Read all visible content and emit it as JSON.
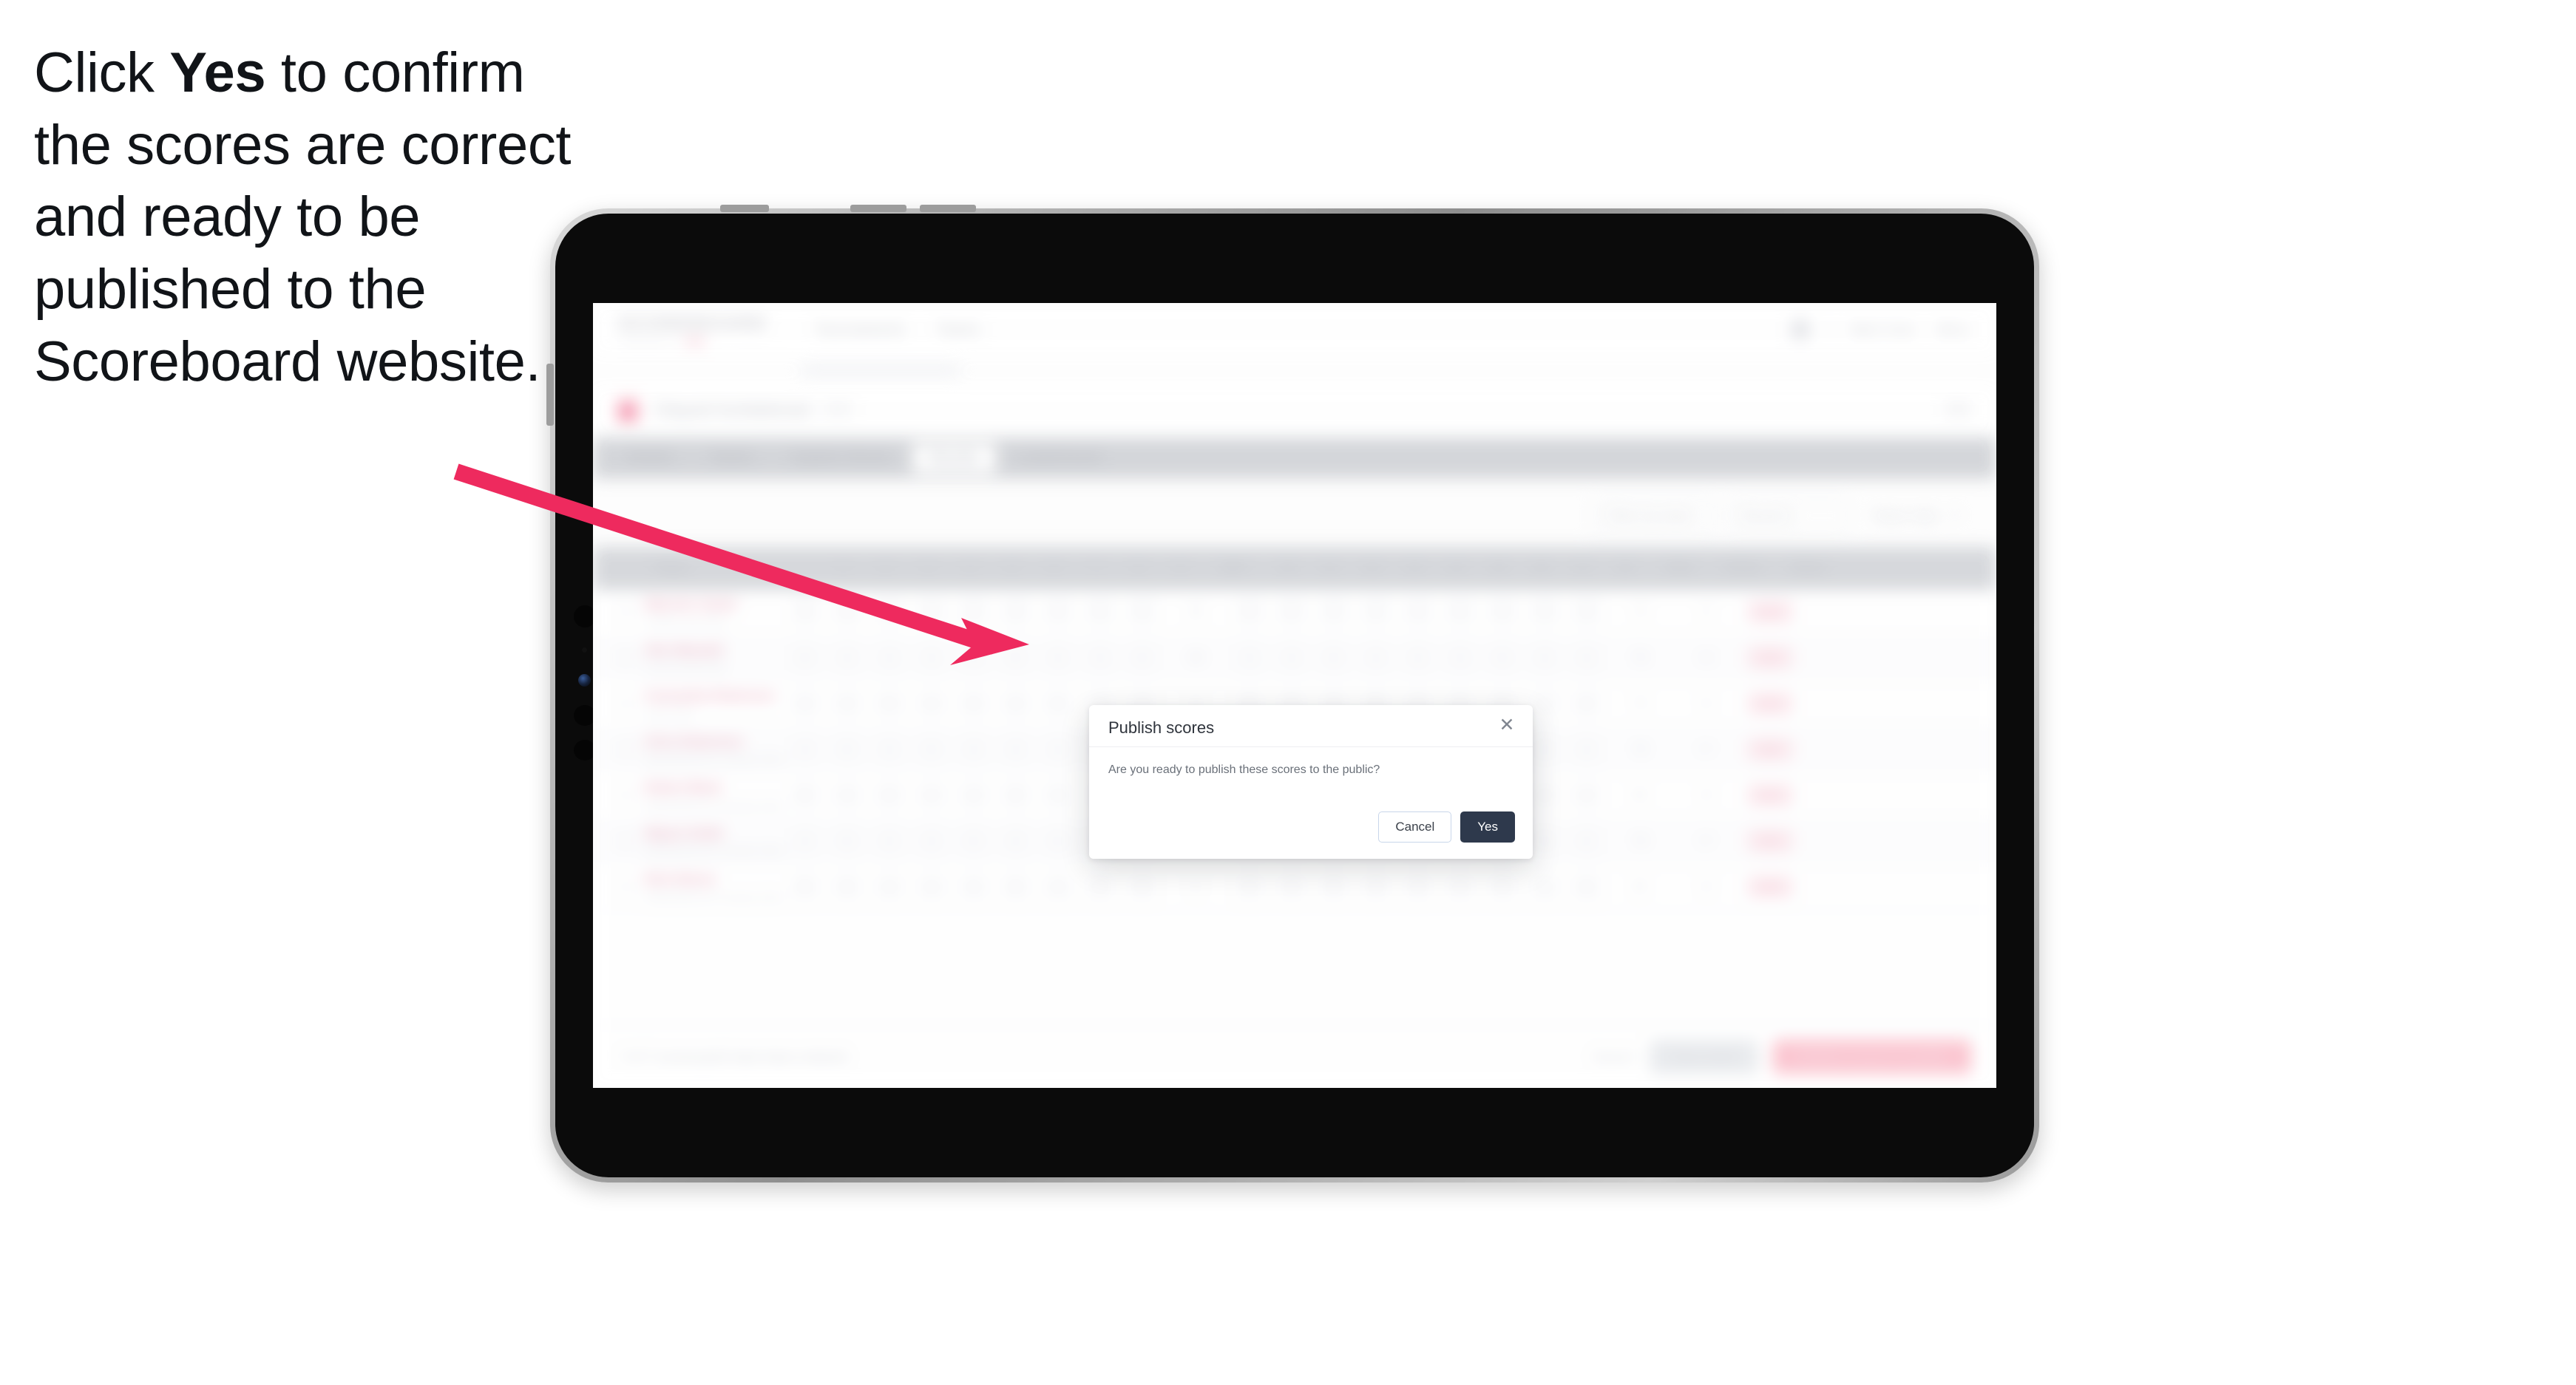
{
  "caption": {
    "before": "Click ",
    "bold": "Yes",
    "after": " to confirm the scores are correct and ready to be published to the Scoreboard website."
  },
  "colors": {
    "arrow": "#ee2a5e",
    "modal_primary": "#2e394c",
    "modal_cancel_border": "#c9d6ea",
    "brand_pink": "#f0708f"
  },
  "modal": {
    "title": "Publish scores",
    "message": "Are you ready to publish these scores to the public?",
    "close_icon": "close-icon",
    "cancel_label": "Cancel",
    "yes_label": "Yes"
  },
  "app": {
    "brand": {
      "word": "SCOREBOARD",
      "sub": "POWERED BY"
    },
    "topnav": [
      "Tournaments",
      "Teams"
    ],
    "topbar_right": {
      "notifications_icon": "bell-icon",
      "user_name": "Matt Coles",
      "menu_label": "Menu"
    },
    "title_strip": {
      "badge_icon": "trophy-icon",
      "title": "Clayed Invitational",
      "meta": "2024",
      "right": "Edit"
    },
    "tabs": [
      {
        "label": "Details",
        "active": false
      },
      {
        "label": "Teams",
        "active": false
      },
      {
        "label": "Captain Sheets",
        "active": false
      },
      {
        "label": "Results",
        "active": true
      },
      {
        "label": "Leaderboard",
        "active": false
      }
    ],
    "filters": [
      {
        "label": "Filter by team",
        "type": "select"
      },
      {
        "label": "Round 1",
        "type": "select"
      },
      {
        "label": "Team only",
        "type": "plain"
      }
    ],
    "table": {
      "columns": {
        "player": "Player",
        "holes": [
          "1",
          "2",
          "3",
          "4",
          "5",
          "6",
          "7",
          "8",
          "9",
          "10",
          "11",
          "12",
          "13",
          "14",
          "15",
          "16",
          "17",
          "18"
        ],
        "out": "OUT",
        "total": "Total",
        "points": "Points",
        "status": "Status"
      },
      "rows": [
        {
          "name": "Malcolm Tymko",
          "team": "Thistle Golf Club",
          "scores": [
            "4",
            "5",
            "4",
            "3",
            "5",
            "4",
            "4",
            "5",
            "4",
            "4",
            "5",
            "4",
            "3",
            "4",
            "5",
            "4",
            "4",
            "4"
          ],
          "out": "38",
          "total": "75",
          "points": "+3",
          "status": "OK"
        },
        {
          "name": "Alex Maxwell",
          "team": "Forest Golf Club",
          "scores": [
            "5",
            "4",
            "4",
            "4",
            "4",
            "5",
            "4",
            "4",
            "5",
            "4",
            "4",
            "5",
            "4",
            "4",
            "4",
            "5",
            "4",
            "4"
          ],
          "out": "39",
          "total": "76",
          "points": "+4",
          "status": "OK"
        },
        {
          "name": "Cassandra Robertson",
          "team": "Lake View",
          "scores": [
            "4",
            "4",
            "5",
            "4",
            "5",
            "4",
            "5",
            "4",
            "4",
            "5",
            "4",
            "4",
            "5",
            "4",
            "4",
            "4",
            "4",
            "5"
          ],
          "out": "39",
          "total": "78",
          "points": "+6",
          "status": "OK"
        },
        {
          "name": "Chris Robertson",
          "team": "Meadowbrook Country Club",
          "scores": [
            "4",
            "5",
            "4",
            "5",
            "4",
            "4",
            "4",
            "5",
            "6",
            "4",
            "4",
            "4",
            "5",
            "4",
            "5",
            "4",
            "4",
            "4"
          ],
          "out": "41",
          "total": "79",
          "points": "+7",
          "status": "OK"
        },
        {
          "name": "Robert Black",
          "team": "Meadowbrook Country Club",
          "scores": [
            "5",
            "4",
            "5",
            "4",
            "4",
            "5",
            "4",
            "4",
            "6",
            "5",
            "4",
            "4",
            "4",
            "5",
            "4",
            "5",
            "4",
            "4"
          ],
          "out": "41",
          "total": "80",
          "points": "+8",
          "status": "OK"
        },
        {
          "name": "Wayne Smith",
          "team": "Meadowbrook Country Club",
          "scores": [
            "4",
            "5",
            "4",
            "4",
            "5",
            "4",
            "5",
            "4",
            "5",
            "4",
            "5",
            "4",
            "4",
            "4",
            "5",
            "4",
            "5",
            "4"
          ],
          "out": "40",
          "total": "79",
          "points": "+7",
          "status": "OK"
        },
        {
          "name": "Rick Nelson",
          "team": "Meadowbrook Country Club",
          "scores": [
            "5",
            "5",
            "4",
            "4",
            "4",
            "5",
            "4",
            "5",
            "5",
            "4",
            "4",
            "5",
            "4",
            "4",
            "4",
            "5",
            "4",
            "5"
          ],
          "out": "41",
          "total": "80",
          "points": "+8",
          "status": "OK"
        }
      ]
    },
    "footer": {
      "note": "7 of 7 scorecards have been entered",
      "cancel_label": "Cancel",
      "save_label": "Save draft",
      "publish_label": "Publish scores to public"
    }
  }
}
